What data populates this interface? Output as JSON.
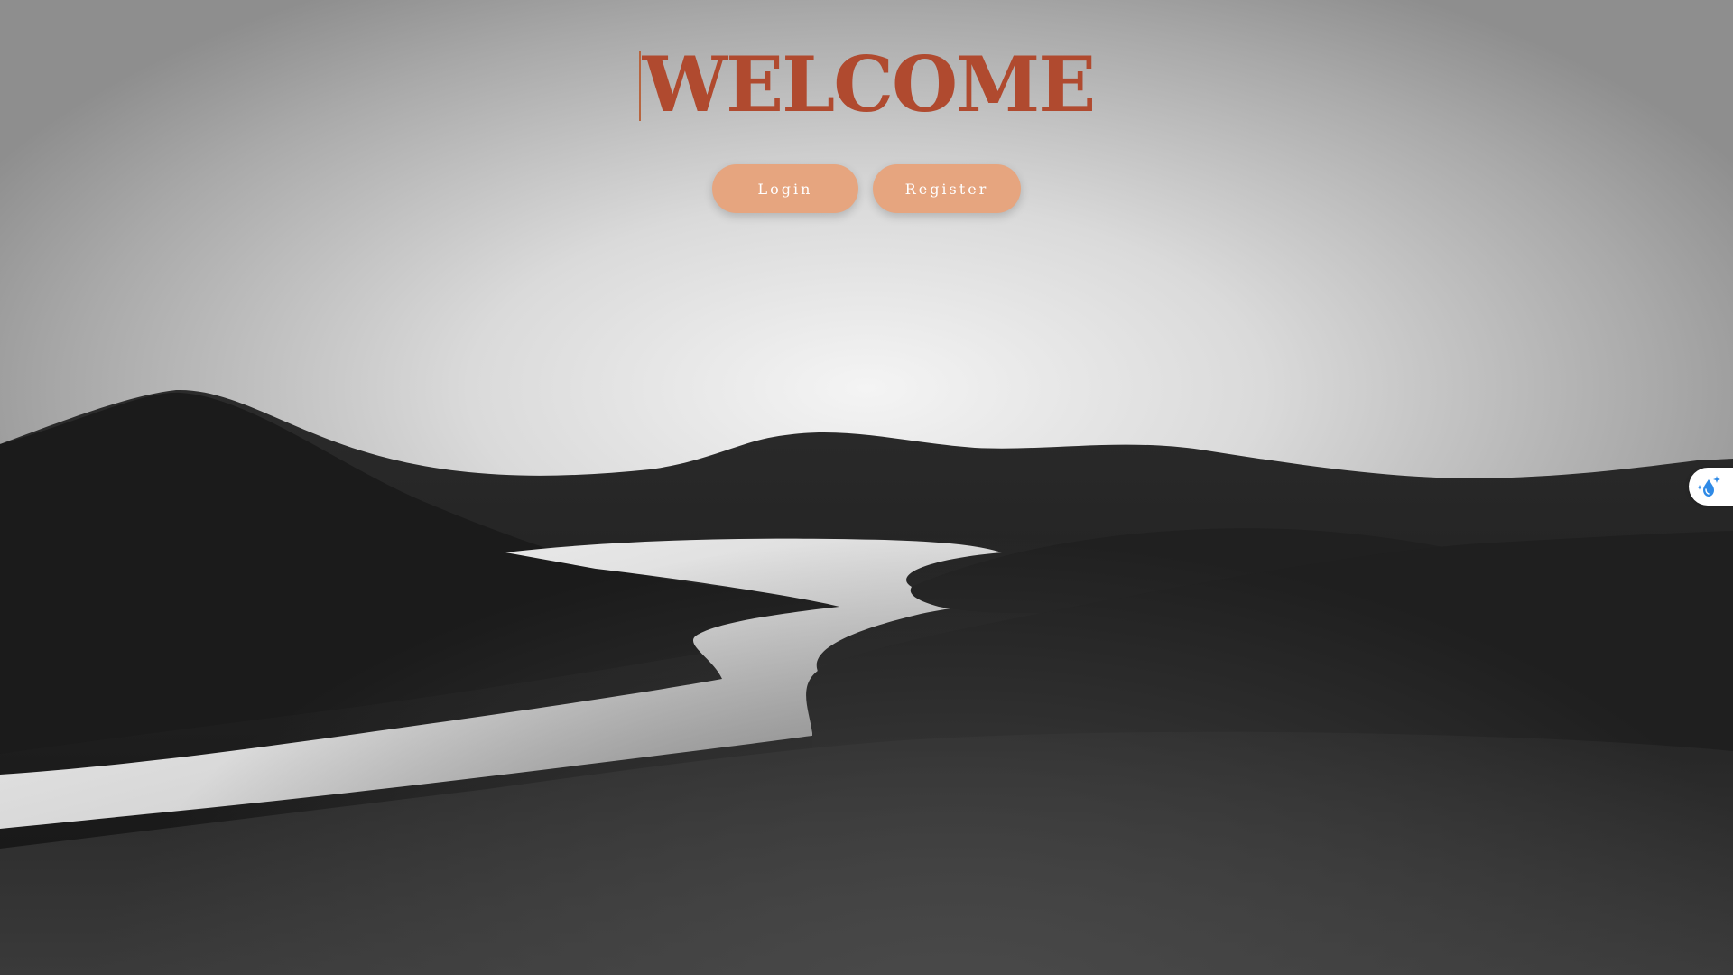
{
  "page": {
    "title": "WELCOME"
  },
  "actions": {
    "login_label": "Login",
    "register_label": "Register"
  },
  "widgets": {
    "side_tab_icon": "water-drop-sparkle-icon"
  },
  "colors": {
    "title": "#b04a2f",
    "button_bg": "#e6a57f",
    "button_text": "#ffffff",
    "dunes": "#1e1e1e",
    "river": "#e8e8e8"
  }
}
